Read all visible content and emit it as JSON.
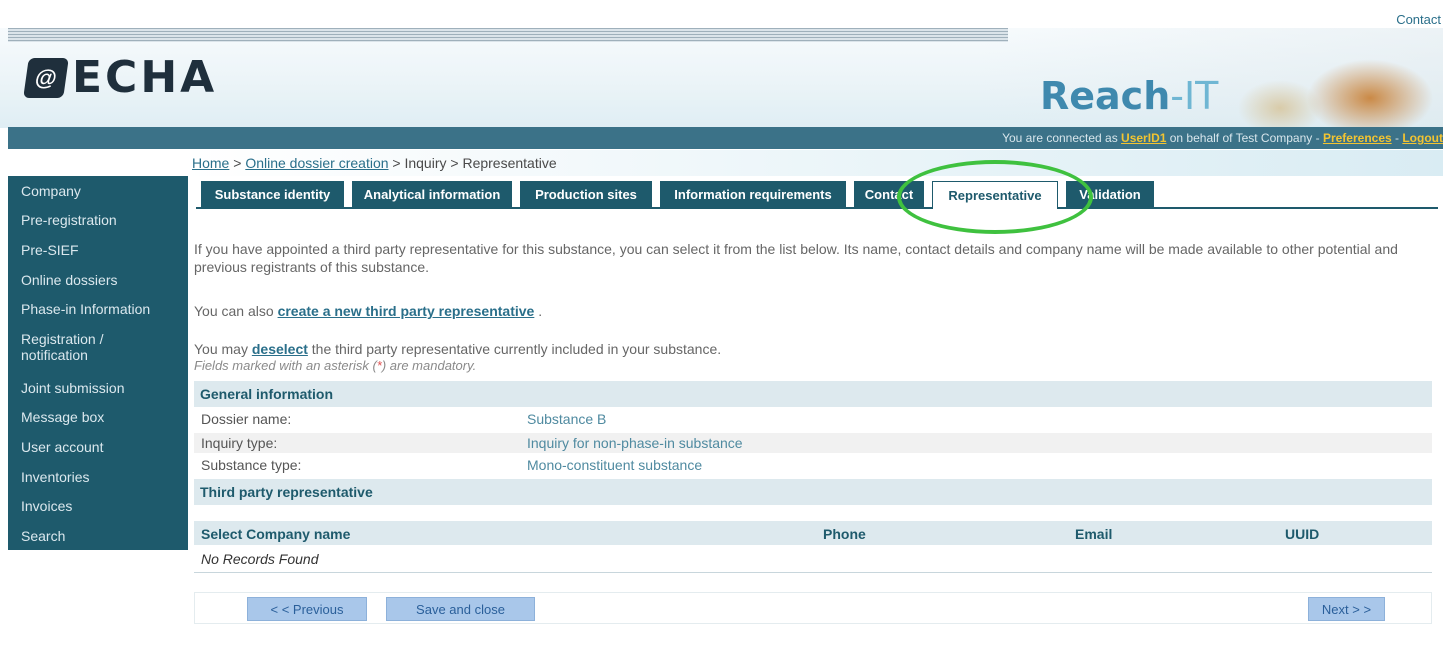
{
  "header": {
    "contact_label": "Contact",
    "logo_text": "ECHA",
    "logo_mark": "@",
    "reach_logo_main": "Reach",
    "reach_logo_dash": "-IT"
  },
  "status": {
    "prefix": "You are connected as ",
    "user": "UserID1",
    "middle": " on behalf of Test Company - ",
    "preferences": "Preferences",
    "sep": " - ",
    "logout": "Logout"
  },
  "breadcrumb": {
    "home": "Home",
    "sep1": " > ",
    "online": "Online dossier creation",
    "sep2": " > Inquiry > ",
    "current": "Representative"
  },
  "sidebar": {
    "items": [
      {
        "label": "Company"
      },
      {
        "label": "Pre-registration"
      },
      {
        "label": "Pre-SIEF"
      },
      {
        "label": "Online dossiers"
      },
      {
        "label": "Phase-in Information"
      },
      {
        "label": "Registration / notification"
      },
      {
        "label": "Joint submission"
      },
      {
        "label": "Message box"
      },
      {
        "label": "User account"
      },
      {
        "label": "Inventories"
      },
      {
        "label": "Invoices"
      },
      {
        "label": "Search"
      }
    ]
  },
  "tabs": [
    {
      "label": "Substance identity"
    },
    {
      "label": "Analytical information"
    },
    {
      "label": "Production sites"
    },
    {
      "label": "Information requirements"
    },
    {
      "label": "Contact"
    },
    {
      "label": "Representative",
      "active": true
    },
    {
      "label": "Validation"
    }
  ],
  "intro": {
    "text": "If you have appointed a third party representative for this substance, you can select it from the list below. Its name, contact details and company name will be made available to other potential and previous registrants of this substance.",
    "create_prefix": "You can also ",
    "create_link": "create a new third party representative",
    "create_suffix": " .",
    "deselect_prefix": "You may ",
    "deselect_link": "deselect",
    "deselect_suffix": " the third party representative currently included in your substance.",
    "mandatory_prefix": "Fields marked with an asterisk (",
    "mandatory_ast": "*",
    "mandatory_suffix": ") are mandatory."
  },
  "general": {
    "title": "General information",
    "rows": [
      {
        "label": "Dossier name:",
        "value": "Substance B"
      },
      {
        "label": "Inquiry type:",
        "value": "Inquiry for non-phase-in substance"
      },
      {
        "label": "Substance type:",
        "value": "Mono-constituent substance"
      }
    ]
  },
  "third_party": {
    "title": "Third party representative",
    "columns": [
      "Select Company name",
      "Phone",
      "Email",
      "UUID"
    ],
    "empty": "No Records Found"
  },
  "buttons": {
    "previous": "< < Previous",
    "save_close": "Save and close",
    "next": "Next > >"
  },
  "colors": {
    "nav_dark": "#1e5a6c",
    "status_bar": "#3b7288",
    "link": "#2a6f8a",
    "annotation": "#3fc13f",
    "button": "#a9c7ea"
  }
}
